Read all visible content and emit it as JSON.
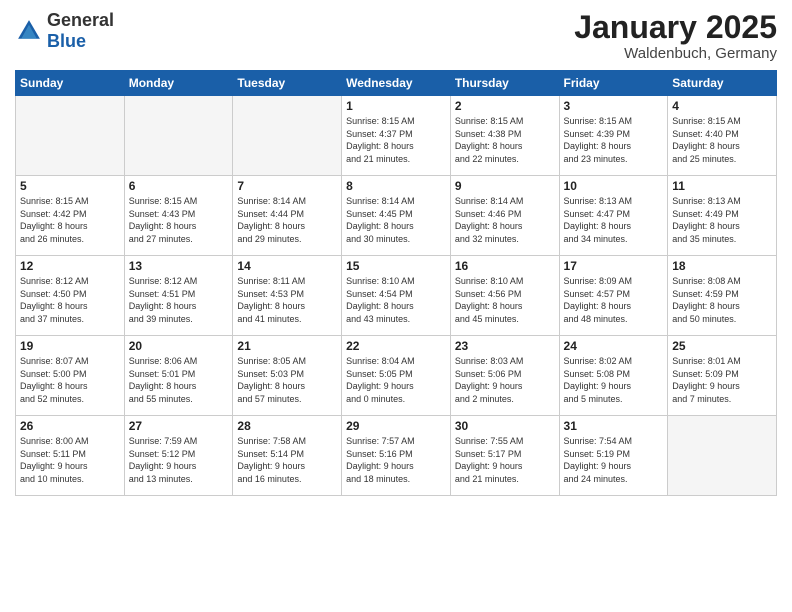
{
  "header": {
    "logo_general": "General",
    "logo_blue": "Blue",
    "title": "January 2025",
    "subtitle": "Waldenbuch, Germany"
  },
  "weekdays": [
    "Sunday",
    "Monday",
    "Tuesday",
    "Wednesday",
    "Thursday",
    "Friday",
    "Saturday"
  ],
  "weeks": [
    [
      {
        "day": "",
        "info": ""
      },
      {
        "day": "",
        "info": ""
      },
      {
        "day": "",
        "info": ""
      },
      {
        "day": "1",
        "info": "Sunrise: 8:15 AM\nSunset: 4:37 PM\nDaylight: 8 hours\nand 21 minutes."
      },
      {
        "day": "2",
        "info": "Sunrise: 8:15 AM\nSunset: 4:38 PM\nDaylight: 8 hours\nand 22 minutes."
      },
      {
        "day": "3",
        "info": "Sunrise: 8:15 AM\nSunset: 4:39 PM\nDaylight: 8 hours\nand 23 minutes."
      },
      {
        "day": "4",
        "info": "Sunrise: 8:15 AM\nSunset: 4:40 PM\nDaylight: 8 hours\nand 25 minutes."
      }
    ],
    [
      {
        "day": "5",
        "info": "Sunrise: 8:15 AM\nSunset: 4:42 PM\nDaylight: 8 hours\nand 26 minutes."
      },
      {
        "day": "6",
        "info": "Sunrise: 8:15 AM\nSunset: 4:43 PM\nDaylight: 8 hours\nand 27 minutes."
      },
      {
        "day": "7",
        "info": "Sunrise: 8:14 AM\nSunset: 4:44 PM\nDaylight: 8 hours\nand 29 minutes."
      },
      {
        "day": "8",
        "info": "Sunrise: 8:14 AM\nSunset: 4:45 PM\nDaylight: 8 hours\nand 30 minutes."
      },
      {
        "day": "9",
        "info": "Sunrise: 8:14 AM\nSunset: 4:46 PM\nDaylight: 8 hours\nand 32 minutes."
      },
      {
        "day": "10",
        "info": "Sunrise: 8:13 AM\nSunset: 4:47 PM\nDaylight: 8 hours\nand 34 minutes."
      },
      {
        "day": "11",
        "info": "Sunrise: 8:13 AM\nSunset: 4:49 PM\nDaylight: 8 hours\nand 35 minutes."
      }
    ],
    [
      {
        "day": "12",
        "info": "Sunrise: 8:12 AM\nSunset: 4:50 PM\nDaylight: 8 hours\nand 37 minutes."
      },
      {
        "day": "13",
        "info": "Sunrise: 8:12 AM\nSunset: 4:51 PM\nDaylight: 8 hours\nand 39 minutes."
      },
      {
        "day": "14",
        "info": "Sunrise: 8:11 AM\nSunset: 4:53 PM\nDaylight: 8 hours\nand 41 minutes."
      },
      {
        "day": "15",
        "info": "Sunrise: 8:10 AM\nSunset: 4:54 PM\nDaylight: 8 hours\nand 43 minutes."
      },
      {
        "day": "16",
        "info": "Sunrise: 8:10 AM\nSunset: 4:56 PM\nDaylight: 8 hours\nand 45 minutes."
      },
      {
        "day": "17",
        "info": "Sunrise: 8:09 AM\nSunset: 4:57 PM\nDaylight: 8 hours\nand 48 minutes."
      },
      {
        "day": "18",
        "info": "Sunrise: 8:08 AM\nSunset: 4:59 PM\nDaylight: 8 hours\nand 50 minutes."
      }
    ],
    [
      {
        "day": "19",
        "info": "Sunrise: 8:07 AM\nSunset: 5:00 PM\nDaylight: 8 hours\nand 52 minutes."
      },
      {
        "day": "20",
        "info": "Sunrise: 8:06 AM\nSunset: 5:01 PM\nDaylight: 8 hours\nand 55 minutes."
      },
      {
        "day": "21",
        "info": "Sunrise: 8:05 AM\nSunset: 5:03 PM\nDaylight: 8 hours\nand 57 minutes."
      },
      {
        "day": "22",
        "info": "Sunrise: 8:04 AM\nSunset: 5:05 PM\nDaylight: 9 hours\nand 0 minutes."
      },
      {
        "day": "23",
        "info": "Sunrise: 8:03 AM\nSunset: 5:06 PM\nDaylight: 9 hours\nand 2 minutes."
      },
      {
        "day": "24",
        "info": "Sunrise: 8:02 AM\nSunset: 5:08 PM\nDaylight: 9 hours\nand 5 minutes."
      },
      {
        "day": "25",
        "info": "Sunrise: 8:01 AM\nSunset: 5:09 PM\nDaylight: 9 hours\nand 7 minutes."
      }
    ],
    [
      {
        "day": "26",
        "info": "Sunrise: 8:00 AM\nSunset: 5:11 PM\nDaylight: 9 hours\nand 10 minutes."
      },
      {
        "day": "27",
        "info": "Sunrise: 7:59 AM\nSunset: 5:12 PM\nDaylight: 9 hours\nand 13 minutes."
      },
      {
        "day": "28",
        "info": "Sunrise: 7:58 AM\nSunset: 5:14 PM\nDaylight: 9 hours\nand 16 minutes."
      },
      {
        "day": "29",
        "info": "Sunrise: 7:57 AM\nSunset: 5:16 PM\nDaylight: 9 hours\nand 18 minutes."
      },
      {
        "day": "30",
        "info": "Sunrise: 7:55 AM\nSunset: 5:17 PM\nDaylight: 9 hours\nand 21 minutes."
      },
      {
        "day": "31",
        "info": "Sunrise: 7:54 AM\nSunset: 5:19 PM\nDaylight: 9 hours\nand 24 minutes."
      },
      {
        "day": "",
        "info": ""
      }
    ]
  ]
}
